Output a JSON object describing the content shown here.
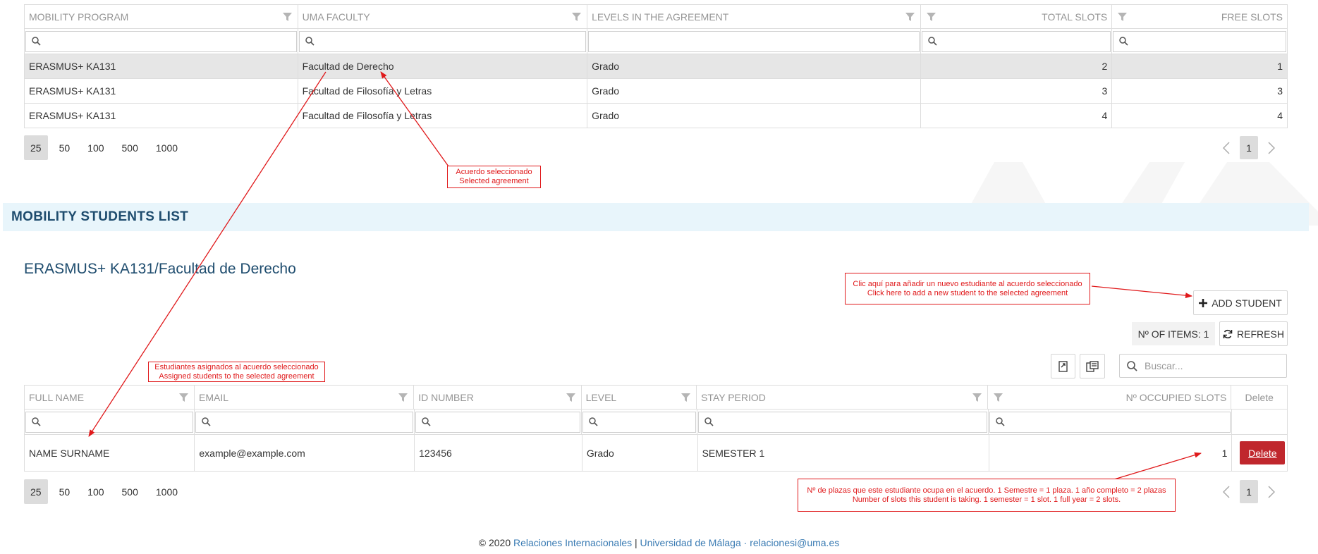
{
  "agreements": {
    "columns": [
      {
        "label": "MOBILITY PROGRAM"
      },
      {
        "label": "UMA FACULTY"
      },
      {
        "label": "LEVELS IN THE AGREEMENT"
      },
      {
        "label": "TOTAL SLOTS"
      },
      {
        "label": "FREE SLOTS"
      }
    ],
    "rows": [
      {
        "program": "ERASMUS+ KA131",
        "faculty": "Facultad de Derecho",
        "level": "Grado",
        "total": "2",
        "free": "1",
        "selected": true
      },
      {
        "program": "ERASMUS+ KA131",
        "faculty": "Facultad de Filosofía y Letras",
        "level": "Grado",
        "total": "3",
        "free": "3",
        "selected": false
      },
      {
        "program": "ERASMUS+ KA131",
        "faculty": "Facultad de Filosofía y Letras",
        "level": "Grado",
        "total": "4",
        "free": "4",
        "selected": false
      }
    ],
    "page_sizes": [
      "25",
      "50",
      "100",
      "500",
      "1000"
    ],
    "current_page": "1"
  },
  "section": {
    "title": "MOBILITY STUDENTS LIST"
  },
  "selected_agreement": {
    "title": "ERASMUS+ KA131/Facultad de Derecho"
  },
  "toolbar": {
    "add_student": "ADD STUDENT",
    "items_count": "Nº OF ITEMS: 1",
    "refresh": "REFRESH",
    "search_placeholder": "Buscar..."
  },
  "students": {
    "columns": [
      {
        "label": "FULL NAME"
      },
      {
        "label": "EMAIL"
      },
      {
        "label": "ID NUMBER"
      },
      {
        "label": "LEVEL"
      },
      {
        "label": "STAY PERIOD"
      },
      {
        "label": "Nº OCCUPIED SLOTS"
      },
      {
        "label": "Delete"
      }
    ],
    "rows": [
      {
        "name": "NAME SURNAME",
        "email": "example@example.com",
        "id": "123456",
        "level": "Grado",
        "stay": "SEMESTER 1",
        "slots": "1",
        "delete": "Delete"
      }
    ],
    "page_sizes": [
      "25",
      "50",
      "100",
      "500",
      "1000"
    ],
    "current_page": "1"
  },
  "annotations": {
    "selected_agreement": [
      "Acuerdo seleccionado",
      "Selected agreement"
    ],
    "add_student": [
      "Clic aquí para añadir un nuevo estudiante al acuerdo seleccionado",
      "Click here to add a new student to the selected agreement"
    ],
    "assigned_students": [
      "Estudiantes asignados al acuerdo seleccionado",
      "Assigned students to the selected agreement"
    ],
    "slots": [
      "Nº de plazas que este estudiante ocupa en el acuerdo. 1 Semestre = 1 plaza. 1 año completo = 2 plazas",
      "Number of slots this student is taking. 1 semester = 1 slot. 1 full year = 2 slots."
    ]
  },
  "footer": {
    "copyright": "© 2020",
    "relaciones": "Relaciones Internacionales",
    "separator": "|",
    "uma": "Universidad de Málaga",
    "dot": "·",
    "email": "relacionesi@uma.es"
  },
  "colors": {
    "accent": "#1e4c6e",
    "link": "#3a7bb3",
    "delete": "#c0272d",
    "annotation": "#e0191b",
    "band": "#e8f5fb"
  }
}
